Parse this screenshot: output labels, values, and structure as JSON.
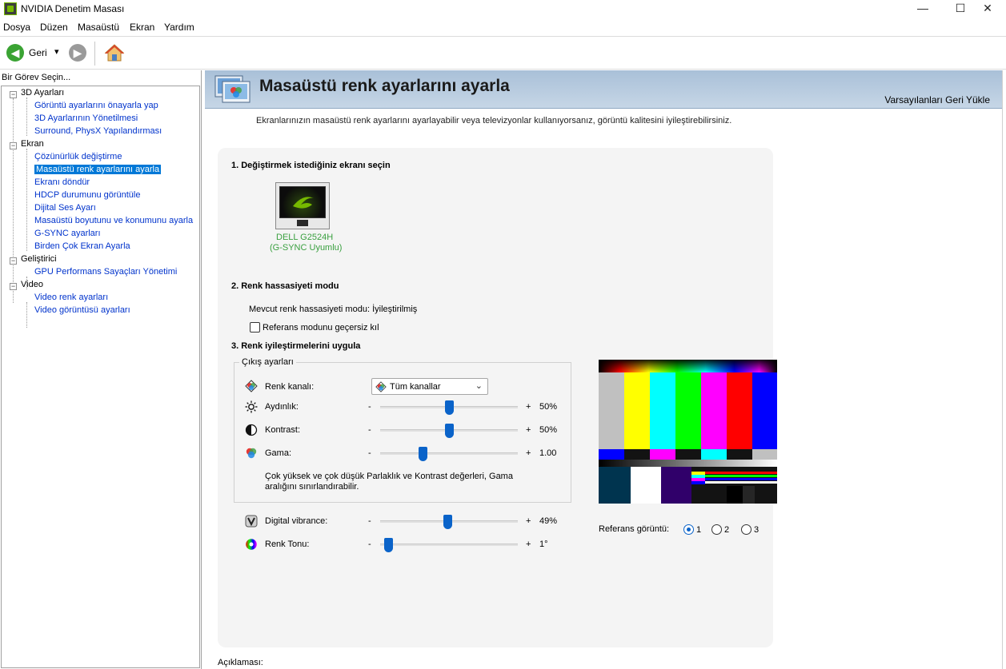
{
  "window": {
    "title": "NVIDIA Denetim Masası",
    "minimize": "—",
    "maximize": "☐",
    "close": "✕"
  },
  "menu": [
    "Dosya",
    "Düzen",
    "Masaüstü",
    "Ekran",
    "Yardım"
  ],
  "toolbar": {
    "back_label": "Geri",
    "dropdown_glyph": "▾"
  },
  "sidebar": {
    "heading": "Bir Görev Seçin...",
    "categories": [
      {
        "label": "3D Ayarları",
        "items": [
          "Görüntü ayarlarını önayarla yap",
          "3D Ayarlarının Yönetilmesi",
          "Surround, PhysX Yapılandırması"
        ]
      },
      {
        "label": "Ekran",
        "items": [
          "Çözünürlük değiştirme",
          "Masaüstü renk ayarlarını ayarla",
          "Ekranı döndür",
          "HDCP durumunu görüntüle",
          "Dijital Ses Ayarı",
          "Masaüstü boyutunu ve konumunu ayarla",
          "G-SYNC ayarları",
          "Birden Çok Ekran Ayarla"
        ]
      },
      {
        "label": "Geliştirici",
        "items": [
          "GPU Performans Sayaçları Yönetimi"
        ]
      },
      {
        "label": "Video",
        "items": [
          "Video renk ayarları",
          "Video görüntüsü ayarları"
        ]
      }
    ],
    "selected": "Masaüstü renk ayarlarını ayarla"
  },
  "page": {
    "title": "Masaüstü renk ayarlarını ayarla",
    "restore_defaults": "Varsayılanları Geri Yükle",
    "description": "Ekranlarınızın masaüstü renk ayarlarını ayarlayabilir veya televizyonlar kullanıyorsanız, görüntü kalitesini iyileştirebilirsiniz.",
    "section1": "1. Değiştirmek istediğiniz ekranı seçin",
    "display_name": "DELL G2524H",
    "display_sub": "(G-SYNC Uyumlu)",
    "section2": "2. Renk hassasiyeti modu",
    "precision_mode": "Mevcut renk hassasiyeti modu: İyileştirilmiş",
    "override_ref": "Referans modunu geçersiz kıl",
    "override_checked": false,
    "section3": "3. Renk iyileştirmelerini uygula",
    "output_group": "Çıkış ayarları",
    "channel_label": "Renk kanalı:",
    "channel_value": "Tüm kanallar",
    "sliders": [
      {
        "label": "Aydınlık:",
        "minus": "-",
        "plus": "+",
        "value": "50%",
        "fraction": 0.5,
        "icon": "sun-icon"
      },
      {
        "label": "Kontrast:",
        "minus": "-",
        "plus": "+",
        "value": "50%",
        "fraction": 0.5,
        "icon": "contrast-icon"
      },
      {
        "label": "Gama:",
        "minus": "-",
        "plus": "+",
        "value": "1.00",
        "fraction": 0.3,
        "icon": "gamma-icon"
      }
    ],
    "warning": [
      "Çok yüksek ve çok düşük Parlaklık ve Kontrast değerleri, Gama",
      "aralığını sınırlandırabilir."
    ],
    "extra_sliders": [
      {
        "label": "Digital vibrance:",
        "minus": "-",
        "plus": "+",
        "value": "49%",
        "fraction": 0.49,
        "icon": "vibrance-icon"
      },
      {
        "label": "Renk Tonu:",
        "minus": "-",
        "plus": "+",
        "value": "1°",
        "fraction": 0.03,
        "icon": "hue-icon"
      }
    ],
    "reference_label": "Referans görüntü:",
    "reference_options": [
      "1",
      "2",
      "3"
    ],
    "reference_selected": "1",
    "footer_label": "Açıklaması:"
  },
  "colors": {
    "accent": "#0a63c9",
    "nvidia_green": "#76b900",
    "link": "#0033cc",
    "banner": "#b7cbe0"
  }
}
